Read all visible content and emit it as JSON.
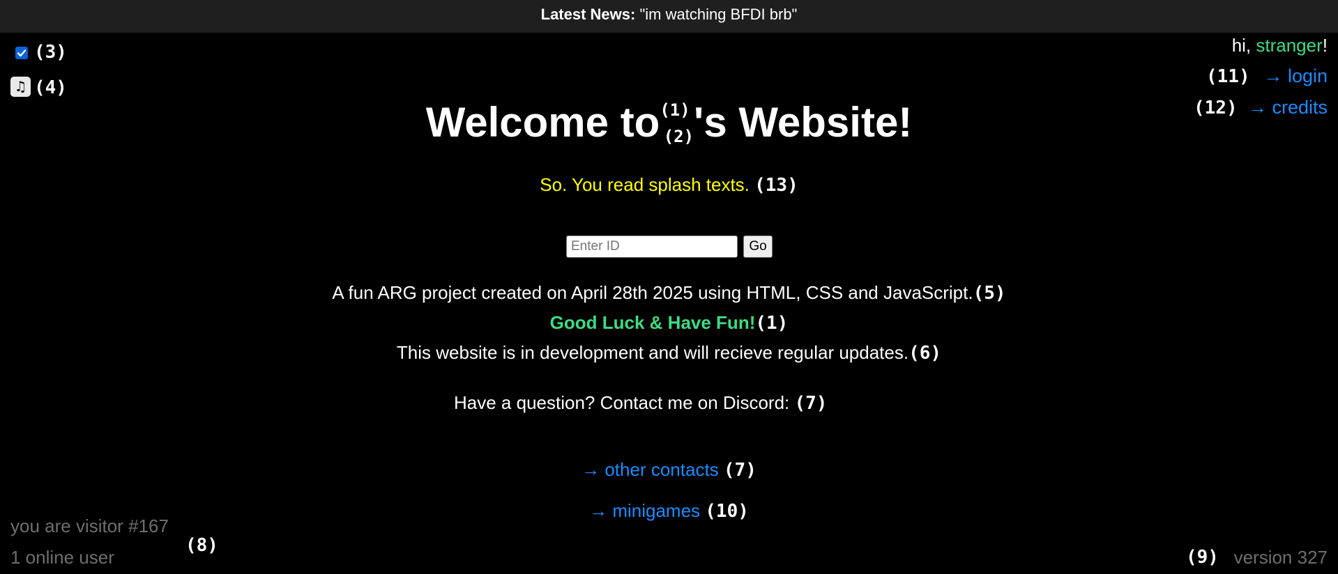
{
  "news": {
    "label": "Latest News:",
    "text": " \"im watching BFDI brb\""
  },
  "greeting": {
    "prefix": "hi, ",
    "name": "stranger",
    "suffix": "!"
  },
  "nav": {
    "login": "→ login",
    "credits": "→ credits",
    "other_contacts": "→ other contacts",
    "minigames": "→ minigames"
  },
  "title": {
    "prefix": "Welcome to",
    "marker_sup": "(1)",
    "marker_sub": "(2)",
    "suffix": "'s Website!"
  },
  "splash": "So. You read splash texts.",
  "id_search": {
    "placeholder": "Enter ID",
    "button": "Go"
  },
  "description": "A fun ARG project created on April 28th 2025 using HTML, CSS and JavaScript.",
  "good_luck": "Good Luck & Have Fun!",
  "dev_notice": "This website is in development and will recieve regular updates.",
  "contact": "Have a question? Contact me on Discord:",
  "footer": {
    "visitor": "you are visitor #167",
    "online": "1 online user",
    "version": "version 327"
  },
  "markers": {
    "m1": "(1)",
    "m3": "(3)",
    "m4": "(4)",
    "m5": "(5)",
    "m6": "(6)",
    "m7": "(7)",
    "m8": "(8)",
    "m9": "(9)",
    "m10": "(10)",
    "m11": "(11)",
    "m12": "(12)",
    "m13": "(13)"
  },
  "icons": {
    "checkbox": "checkbox-checked-icon",
    "music": "music-note-icon"
  },
  "colors": {
    "background": "#000000",
    "news_bar": "#1f1f1f",
    "link": "#1a8cff",
    "green": "#3ddc84",
    "splash_yellow": "#ffff00",
    "muted_gray": "#6e6e6e",
    "checkbox_blue": "#0b62d6"
  }
}
